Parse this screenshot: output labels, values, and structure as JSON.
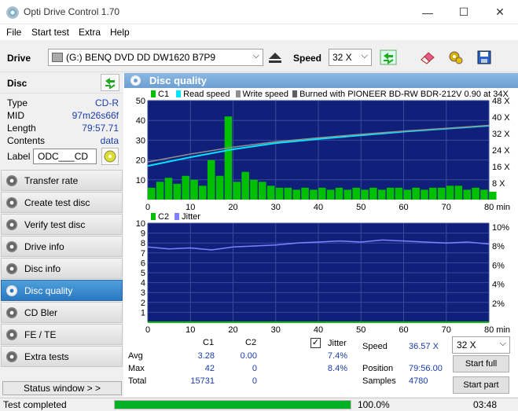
{
  "window": {
    "title": "Opti Drive Control 1.70",
    "minimize": "—",
    "maximize": "☐",
    "close": "✕"
  },
  "menu": [
    "File",
    "Start test",
    "Extra",
    "Help"
  ],
  "toolbar": {
    "drive_label": "Drive",
    "drive_value": "(G:)   BENQ DVD DD DW1620 B7P9",
    "speed_label": "Speed",
    "speed_value": "32 X"
  },
  "disc": {
    "header": "Disc",
    "rows": [
      {
        "key": "Type",
        "value": "CD-R"
      },
      {
        "key": "MID",
        "value": "97m26s66f"
      },
      {
        "key": "Length",
        "value": "79:57.71"
      },
      {
        "key": "Contents",
        "value": "data"
      }
    ],
    "label_key": "Label",
    "label_value": "ODC___CD"
  },
  "nav": [
    "Transfer rate",
    "Create test disc",
    "Verify test disc",
    "Drive info",
    "Disc info",
    "Disc quality",
    "CD Bler",
    "FE / TE",
    "Extra tests"
  ],
  "nav_active": "Disc quality",
  "status_window": "Status window > >",
  "status": {
    "text": "Test completed",
    "progress": 1.0,
    "percent": "100.0%",
    "time": "03:48"
  },
  "panel_title": "Disc quality",
  "chart_data": [
    {
      "type": "area",
      "legend": [
        "C1",
        "Read speed",
        "Write speed",
        "Burned with PIONEER BD-RW   BDR-212V 0.90 at 34X"
      ],
      "xlim": [
        0,
        80
      ],
      "x_ticks": [
        "0",
        "10",
        "20",
        "30",
        "40",
        "50",
        "60",
        "70",
        "80 min"
      ],
      "ylim": [
        0,
        50
      ],
      "y_ticks": [
        "10",
        "20",
        "30",
        "40",
        "50"
      ],
      "y2_ticks": [
        "8 X",
        "16 X",
        "24 X",
        "32 X",
        "40 X",
        "48 X"
      ],
      "series": [
        {
          "name": "C1",
          "color": "#00c000",
          "x": [
            0,
            2,
            4,
            6,
            8,
            10,
            12,
            14,
            16,
            18,
            20,
            22,
            24,
            26,
            28,
            30,
            32,
            34,
            36,
            38,
            40,
            42,
            44,
            46,
            48,
            50,
            52,
            54,
            56,
            58,
            60,
            62,
            64,
            66,
            68,
            70,
            72,
            74,
            76,
            78,
            80
          ],
          "values": [
            6,
            9,
            11,
            8,
            12,
            10,
            7,
            20,
            12,
            42,
            9,
            14,
            10,
            9,
            7,
            6,
            6,
            5,
            6,
            5,
            6,
            5,
            6,
            5,
            6,
            5,
            6,
            5,
            6,
            6,
            5,
            6,
            5,
            6,
            6,
            7,
            7,
            5,
            6,
            5,
            4
          ]
        },
        {
          "name": "Read speed",
          "color": "#00e5ff",
          "x": [
            0,
            10,
            20,
            30,
            40,
            50,
            60,
            70,
            80
          ],
          "values": [
            17.0,
            21.4,
            25.4,
            28.5,
            30.6,
            32.5,
            34.3,
            35.8,
            37.3
          ]
        },
        {
          "name": "Write speed",
          "color": "#909090",
          "x": [
            0,
            10,
            20,
            30,
            40,
            50,
            60,
            70,
            80
          ],
          "values": [
            19.0,
            23.0,
            26.5,
            29.2,
            31.2,
            33.0,
            34.6,
            36.0,
            37.5
          ]
        }
      ]
    },
    {
      "type": "line",
      "legend": [
        "C2",
        "Jitter"
      ],
      "xlim": [
        0,
        80
      ],
      "x_ticks": [
        "0",
        "10",
        "20",
        "30",
        "40",
        "50",
        "60",
        "70",
        "80 min"
      ],
      "ylim": [
        0,
        10
      ],
      "y_ticks": [
        "1",
        "2",
        "3",
        "4",
        "5",
        "6",
        "7",
        "8",
        "9",
        "10"
      ],
      "y2_ticks": [
        "2%",
        "4%",
        "6%",
        "8%",
        "10%"
      ],
      "series": [
        {
          "name": "C2",
          "color": "#00c000",
          "x": [
            0,
            80
          ],
          "values": [
            0,
            0
          ]
        },
        {
          "name": "Jitter",
          "color": "#8080ff",
          "x": [
            0,
            5,
            10,
            15,
            20,
            25,
            30,
            35,
            40,
            45,
            50,
            55,
            60,
            65,
            70,
            75,
            80
          ],
          "values": [
            7.6,
            7.4,
            7.5,
            7.3,
            7.6,
            7.7,
            7.8,
            8.0,
            8.1,
            8.2,
            8.1,
            8.3,
            8.2,
            8.1,
            8.0,
            8.1,
            7.9
          ]
        }
      ]
    }
  ],
  "stats": {
    "col_c1": "C1",
    "col_c2": "C2",
    "rows": [
      {
        "k": "Avg",
        "c1": "3.28",
        "c2": "0.00"
      },
      {
        "k": "Max",
        "c1": "42",
        "c2": "0"
      },
      {
        "k": "Total",
        "c1": "15731",
        "c2": "0"
      }
    ],
    "jitter_label": "Jitter",
    "jitter_checked": true,
    "jitter_avg": "7.4%",
    "jitter_max": "8.4%",
    "speed_label": "Speed",
    "speed_value": "36.57 X",
    "position_label": "Position",
    "position_value": "79:56.00",
    "samples_label": "Samples",
    "samples_value": "4780",
    "speed_select": "32 X",
    "start_full": "Start full",
    "start_part": "Start part"
  },
  "colors": {
    "chart_bg": "#0f1f7a",
    "grid": "#3a4aa0",
    "accent": "#2a78c0"
  }
}
